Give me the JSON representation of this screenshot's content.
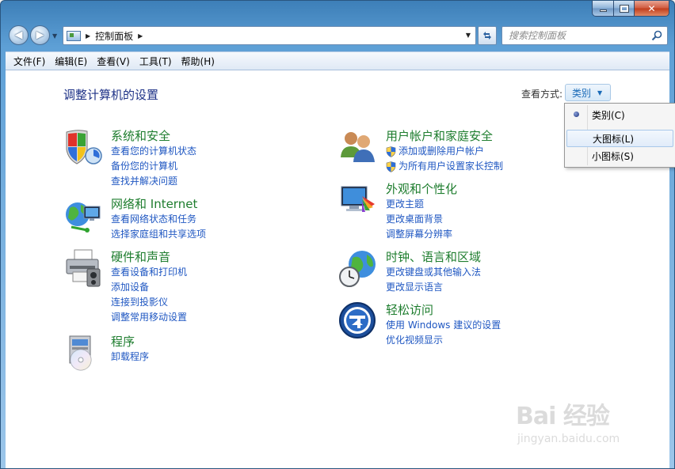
{
  "window": {
    "caption_min": "",
    "caption_max": "",
    "caption_close": "✕"
  },
  "nav": {
    "back_glyph": "◀",
    "forward_glyph": "▶",
    "breadcrumb": "控制面板",
    "search_placeholder": "搜索控制面板"
  },
  "menubar": {
    "items": [
      "文件(F)",
      "编辑(E)",
      "查看(V)",
      "工具(T)",
      "帮助(H)"
    ]
  },
  "main": {
    "title": "调整计算机的设置",
    "view_by_label": "查看方式:",
    "view_by_value": "类别"
  },
  "categories": {
    "system": {
      "title": "系统和安全",
      "icon": "shield-icon",
      "links": [
        "查看您的计算机状态",
        "备份您的计算机",
        "查找并解决问题"
      ]
    },
    "network": {
      "title": "网络和 Internet",
      "icon": "network-globe-icon",
      "links": [
        "查看网络状态和任务",
        "选择家庭组和共享选项"
      ]
    },
    "hardware": {
      "title": "硬件和声音",
      "icon": "printer-icon",
      "links": [
        "查看设备和打印机",
        "添加设备",
        "连接到投影仪",
        "调整常用移动设置"
      ]
    },
    "programs": {
      "title": "程序",
      "icon": "programs-disc-icon",
      "links": [
        "卸载程序"
      ]
    },
    "users": {
      "title": "用户帐户和家庭安全",
      "icon": "users-icon",
      "links": [
        "添加或删除用户帐户",
        "为所有用户设置家长控制"
      ]
    },
    "appearance": {
      "title": "外观和个性化",
      "icon": "display-palette-icon",
      "links": [
        "更改主题",
        "更改桌面背景",
        "调整屏幕分辨率"
      ]
    },
    "clock": {
      "title": "时钟、语言和区域",
      "icon": "clock-globe-icon",
      "links": [
        "更改键盘或其他输入法",
        "更改显示语言"
      ]
    },
    "access": {
      "title": "轻松访问",
      "icon": "ease-of-access-icon",
      "links": [
        "使用 Windows 建议的设置",
        "优化视频显示"
      ]
    }
  },
  "dropdown": {
    "items": [
      "类别(C)",
      "大图标(L)",
      "小图标(S)"
    ],
    "selected": "类别(C)",
    "hovered": "大图标(L)"
  },
  "watermark": {
    "brand": "Bai 经验",
    "url": "jingyan.baidu.com"
  },
  "colors": {
    "category_title": "#1e7d2e",
    "link": "#1f57c2",
    "page_title": "#1e3287"
  }
}
